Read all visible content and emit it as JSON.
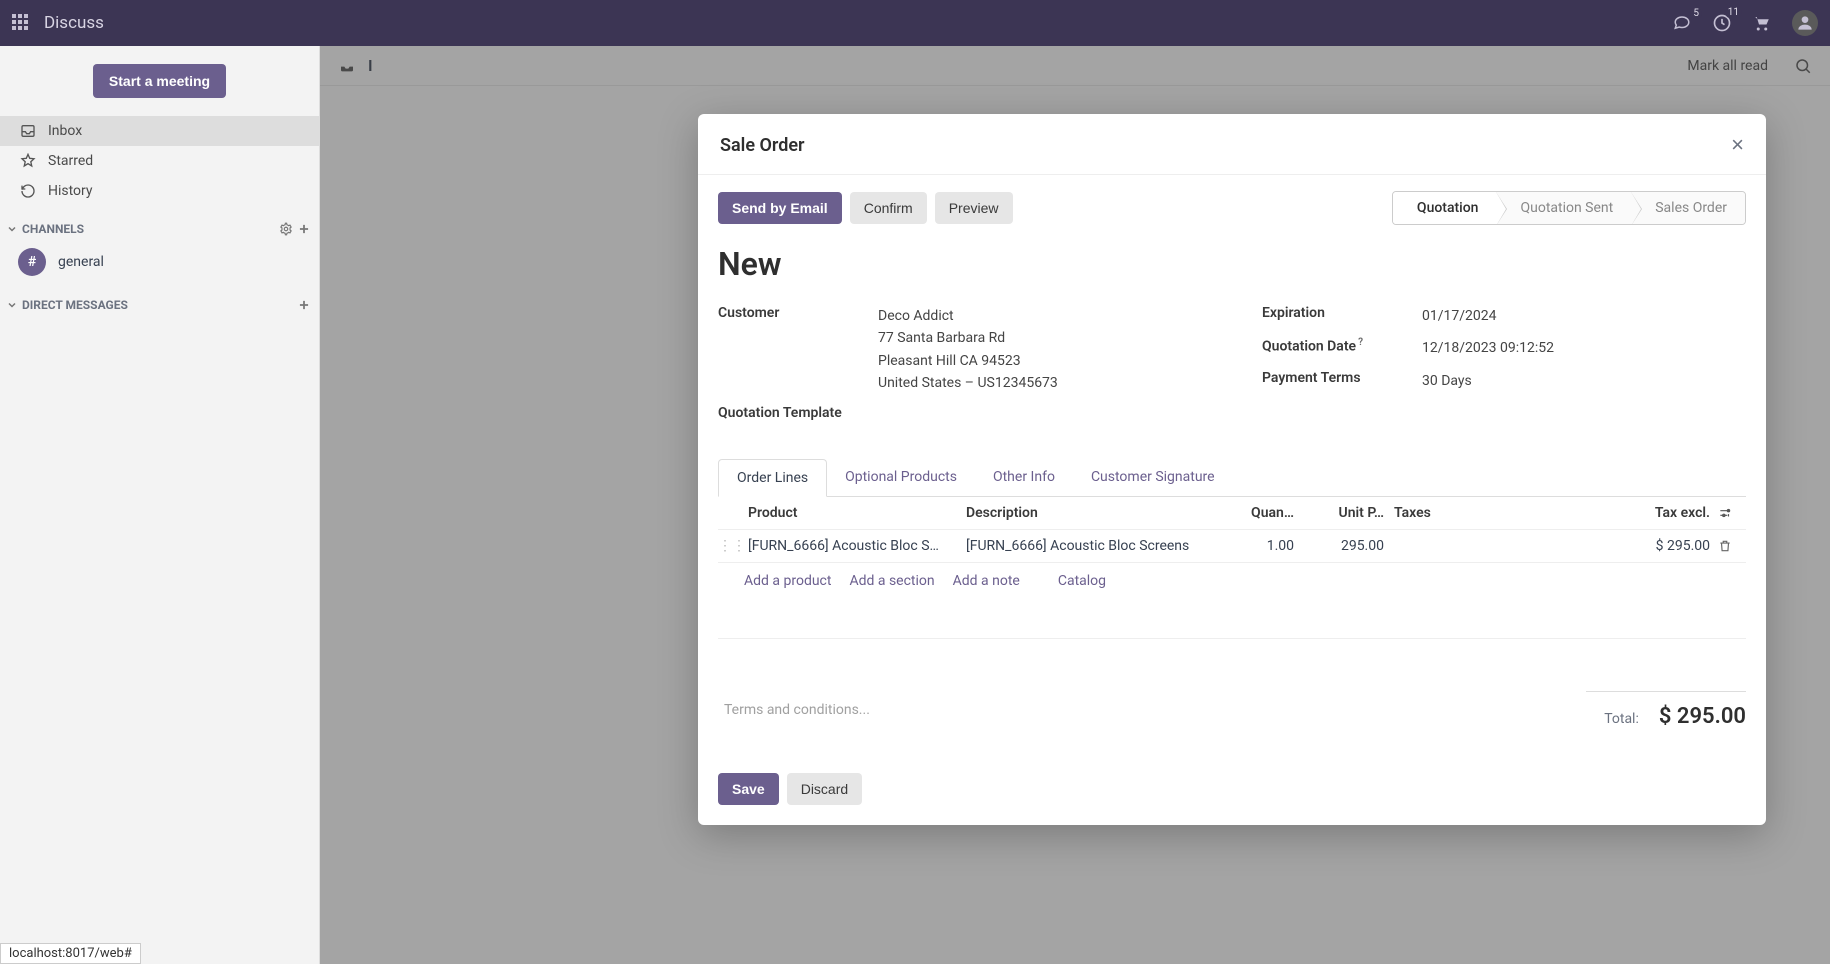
{
  "topnav": {
    "app_name": "Discuss",
    "messages_badge": "5",
    "activity_badge": "11"
  },
  "sidebar": {
    "start_meeting": "Start a meeting",
    "inbox": "Inbox",
    "starred": "Starred",
    "history": "History",
    "channels_label": "CHANNELS",
    "general": "general",
    "dm_label": "DIRECT MESSAGES"
  },
  "main_header": {
    "title_char": "I",
    "mark_all_read": "Mark all read"
  },
  "modal": {
    "title": "Sale Order",
    "buttons": {
      "send_email": "Send by Email",
      "confirm": "Confirm",
      "preview": "Preview",
      "save": "Save",
      "discard": "Discard"
    },
    "stages": {
      "quotation": "Quotation",
      "quotation_sent": "Quotation Sent",
      "sales_order": "Sales Order"
    },
    "record_title": "New",
    "fields": {
      "customer_label": "Customer",
      "customer_name": "Deco Addict",
      "customer_addr1": "77 Santa Barbara Rd",
      "customer_addr2": "Pleasant Hill CA 94523",
      "customer_addr3": "United States – US12345673",
      "expiration_label": "Expiration",
      "expiration_value": "01/17/2024",
      "quotation_date_label": "Quotation Date",
      "quotation_date_help": "?",
      "quotation_date_value": "12/18/2023 09:12:52",
      "payment_terms_label": "Payment Terms",
      "payment_terms_value": "30 Days",
      "quotation_template_label": "Quotation Template"
    },
    "tabs": {
      "order_lines": "Order Lines",
      "optional_products": "Optional Products",
      "other_info": "Other Info",
      "customer_signature": "Customer Signature"
    },
    "table": {
      "headers": {
        "product": "Product",
        "description": "Description",
        "quantity": "Quan…",
        "unit_price": "Unit P…",
        "taxes": "Taxes",
        "tax_excl": "Tax excl."
      },
      "rows": [
        {
          "product": "[FURN_6666] Acoustic Bloc S…",
          "description": "[FURN_6666] Acoustic Bloc Screens",
          "quantity": "1.00",
          "unit_price": "295.00",
          "taxes": "",
          "tax_excl": "$ 295.00"
        }
      ],
      "add_product": "Add a product",
      "add_section": "Add a section",
      "add_note": "Add a note",
      "catalog": "Catalog"
    },
    "terms_placeholder": "Terms and conditions...",
    "total_label": "Total:",
    "total_amount": "$ 295.00"
  },
  "status_bar": "localhost:8017/web#"
}
